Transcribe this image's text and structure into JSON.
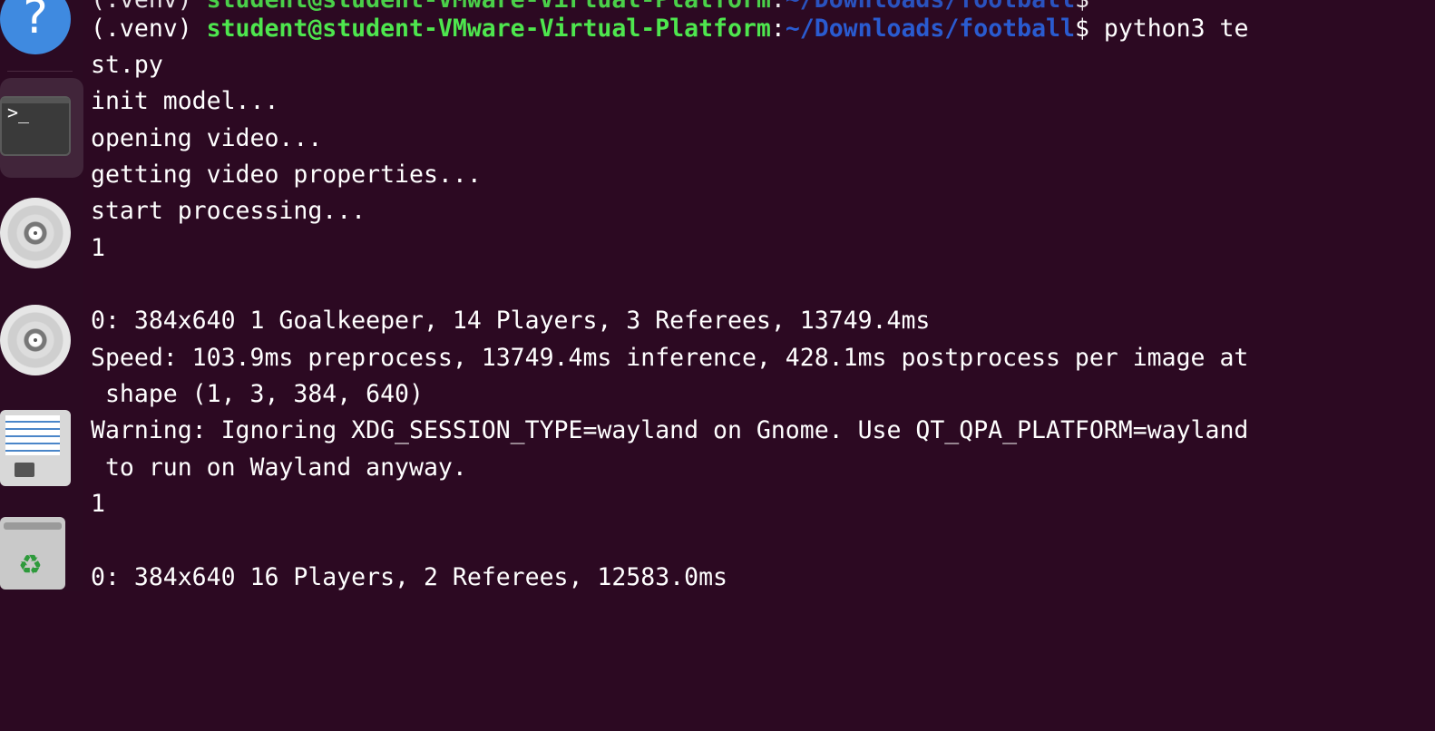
{
  "dock": {
    "help_glyph": "?",
    "terminal_glyph": ">_",
    "trash_glyph": "♻"
  },
  "terminal": {
    "partial_prev_prompt": {
      "venv": "(.venv) ",
      "user_host": "student@student-VMware-Virtual-Platform",
      "colon": ":",
      "path": "~/Downloads/football",
      "dollar": "$"
    },
    "prompt": {
      "venv": "(.venv) ",
      "user_host": "student@student-VMware-Virtual-Platform",
      "colon": ":",
      "path": "~/Downloads/football",
      "dollar": "$",
      "command": " python3 te"
    },
    "lines": [
      "st.py",
      "init model...",
      "opening video...",
      "getting video properties...",
      "start processing...",
      "1",
      "",
      "0: 384x640 1 Goalkeeper, 14 Players, 3 Referees, 13749.4ms",
      "Speed: 103.9ms preprocess, 13749.4ms inference, 428.1ms postprocess per image at",
      " shape (1, 3, 384, 640)",
      "Warning: Ignoring XDG_SESSION_TYPE=wayland on Gnome. Use QT_QPA_PLATFORM=wayland",
      " to run on Wayland anyway.",
      "1",
      "",
      "0: 384x640 16 Players, 2 Referees, 12583.0ms"
    ]
  },
  "colors": {
    "background": "#2c0922",
    "prompt_user": "#4ee64e",
    "prompt_path": "#2a5bd0",
    "text": "#ffffff"
  }
}
